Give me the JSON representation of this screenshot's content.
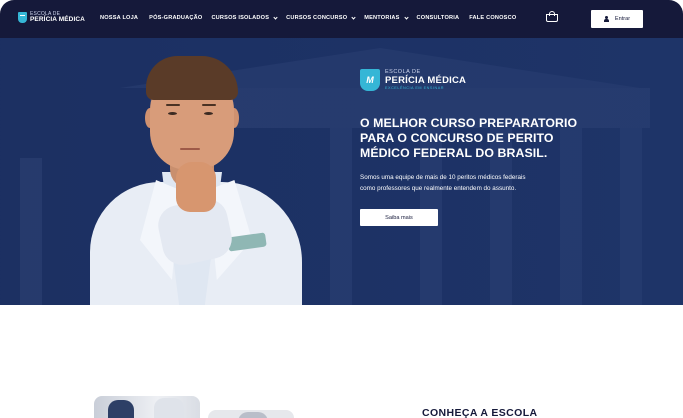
{
  "header": {
    "logo": {
      "line1": "ESCOLA DE",
      "line2": "PERÍCIA MÉDICA"
    },
    "menu": [
      {
        "label": "NOSSA LOJA",
        "dropdown": false
      },
      {
        "label": "PÓS-GRADUAÇÃO",
        "dropdown": false
      },
      {
        "label": "CURSOS ISOLADOS",
        "dropdown": true
      },
      {
        "label": "CURSOS CONCURSO",
        "dropdown": true
      },
      {
        "label": "MENTORIAS",
        "dropdown": true
      },
      {
        "label": "CONSULTORIA",
        "dropdown": false
      },
      {
        "label": "FALE CONOSCO",
        "dropdown": false
      }
    ],
    "cart_icon": "shopping-bag-icon",
    "login_button": "Entrar",
    "login_icon": "user-icon"
  },
  "hero": {
    "brand": {
      "badge": "M",
      "line1": "ESCOLA DE",
      "line2": "PERÍCIA MÉDICA",
      "tagline": "EXCELÊNCIA EM ENSINAR"
    },
    "headline_lines": [
      "O MELHOR CURSO PREPARATORIO",
      "PARA O CONCURSO DE PERITO",
      "MÉDICO FEDERAL DO BRASIL."
    ],
    "subtext_lines": [
      "Somos uma equipe de mais de 10 peritos médicos federais",
      "como professores que realmente entendem do assunto."
    ],
    "cta": "Saiba mais"
  },
  "section2": {
    "title": "CONHEÇA A ESCOLA"
  },
  "colors": {
    "nav_bg": "#15193a",
    "hero_bg": "#1e3468",
    "accent": "#35b6d6",
    "white": "#ffffff"
  }
}
